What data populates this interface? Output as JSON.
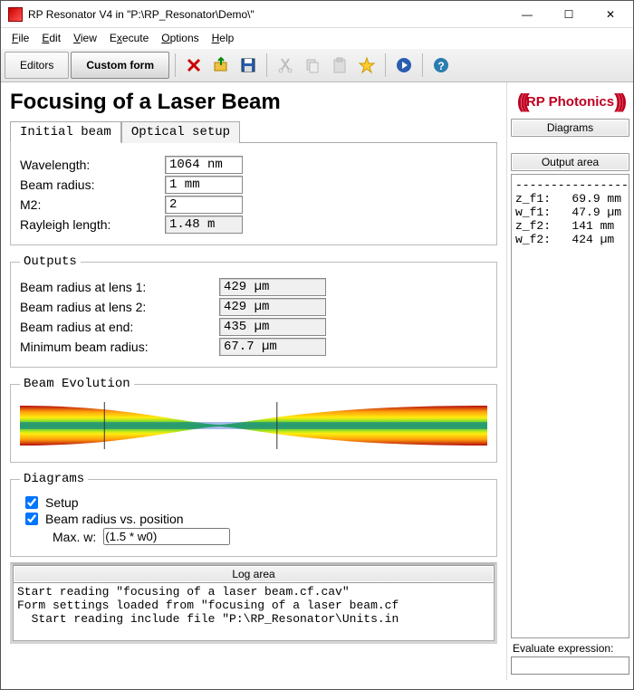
{
  "window": {
    "title": "RP Resonator V4 in \"P:\\RP_Resonator\\Demo\\\"",
    "min_icon": "—",
    "max_icon": "☐",
    "close_icon": "✕"
  },
  "menu": {
    "file": "File",
    "edit": "Edit",
    "view": "View",
    "execute": "Execute",
    "options": "Options",
    "help": "Help"
  },
  "toolbar": {
    "editors": "Editors",
    "custom_form": "Custom form"
  },
  "page": {
    "title": "Focusing of a Laser Beam",
    "tabs": {
      "initial": "Initial beam",
      "optical": "Optical setup"
    },
    "inputs": {
      "wavelength_label": "Wavelength:",
      "wavelength": "1064 nm",
      "radius_label": "Beam radius:",
      "radius": "1 mm",
      "m2_label": "M2:",
      "m2": "2",
      "rayleigh_label": "Rayleigh length:",
      "rayleigh": "1.48 m"
    },
    "outputs_legend": "Outputs",
    "outputs": {
      "lens1_label": "Beam radius at lens 1:",
      "lens1": "429 µm",
      "lens2_label": "Beam radius at lens 2:",
      "lens2": "429 µm",
      "end_label": "Beam radius at end:",
      "end": "435 µm",
      "min_label": "Minimum beam radius:",
      "min": "67.7 µm"
    },
    "beam_legend": "Beam Evolution",
    "diagrams_legend": "Diagrams",
    "diagrams": {
      "setup": "Setup",
      "radius_pos": "Beam radius vs. position",
      "maxw_label": "Max. w:",
      "maxw": "(1.5 * w0)"
    }
  },
  "log": {
    "header": "Log area",
    "text": "Start reading \"focusing of a laser beam.cf.cav\"\nForm settings loaded from \"focusing of a laser beam.cf\n  Start reading include file \"P:\\RP_Resonator\\Units.in"
  },
  "right": {
    "logo": "RP Photonics",
    "diagrams_header": "Diagrams",
    "output_header": "Output area",
    "output_text": "-----------------\nz_f1:   69.9 mm\nw_f1:   47.9 µm\nz_f2:   141 mm\nw_f2:   424 µm",
    "eval_label": "Evaluate expression:",
    "eval_value": ""
  }
}
